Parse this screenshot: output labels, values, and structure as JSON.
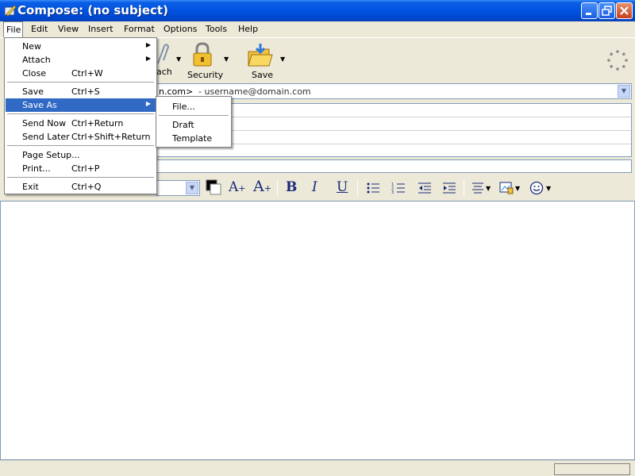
{
  "window": {
    "title": "Compose: (no subject)"
  },
  "menubar": {
    "items": [
      "File",
      "Edit",
      "View",
      "Insert",
      "Format",
      "Options",
      "Tools",
      "Help"
    ]
  },
  "toolbar": {
    "attach_label": "ach",
    "security_label": "Security",
    "save_label": "Save"
  },
  "compose": {
    "from_partial": "n.com>",
    "from_address": "- username@domain.com"
  },
  "file_menu": {
    "items": [
      {
        "label": "New",
        "shortcut": "",
        "submenu": true
      },
      {
        "label": "Attach",
        "shortcut": "",
        "submenu": true
      },
      {
        "label": "Close",
        "shortcut": "Ctrl+W"
      },
      {
        "label": "Save",
        "shortcut": "Ctrl+S"
      },
      {
        "label": "Save As",
        "shortcut": "",
        "submenu": true,
        "highlighted": true
      },
      {
        "label": "Send Now",
        "shortcut": "Ctrl+Return"
      },
      {
        "label": "Send Later",
        "shortcut": "Ctrl+Shift+Return"
      },
      {
        "label": "Page Setup...",
        "shortcut": ""
      },
      {
        "label": "Print...",
        "shortcut": "Ctrl+P"
      },
      {
        "label": "Exit",
        "shortcut": "Ctrl+Q"
      }
    ]
  },
  "save_as_menu": {
    "items": [
      "File...",
      "Draft",
      "Template"
    ]
  },
  "colors": {
    "title_bar": "#0052e0",
    "highlight": "#316ac5",
    "chrome": "#ece9d8"
  }
}
